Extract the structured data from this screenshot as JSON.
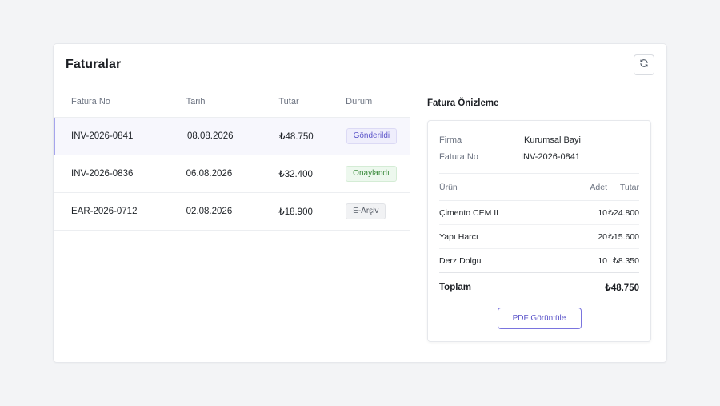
{
  "header": {
    "title": "Faturalar",
    "refresh_icon": "refresh-icon"
  },
  "invoices": {
    "columns": [
      "Fatura No",
      "Tarih",
      "Tutar",
      "Durum"
    ],
    "rows": [
      {
        "no": "INV-2026-0841",
        "date": "08.08.2026",
        "amount": "₺48.750",
        "status": "Gönderildi",
        "status_type": "sent",
        "selected": true
      },
      {
        "no": "INV-2026-0836",
        "date": "06.08.2026",
        "amount": "₺32.400",
        "status": "Onaylandı",
        "status_type": "approved",
        "selected": false
      },
      {
        "no": "EAR-2026-0712",
        "date": "02.08.2026",
        "amount": "₺18.900",
        "status": "E-Arşiv",
        "status_type": "archive",
        "selected": false
      }
    ]
  },
  "preview": {
    "title": "Fatura Önizleme",
    "firma_label": "Firma",
    "firma_value": "Kurumsal Bayi",
    "invoice_label": "Fatura No",
    "invoice_value": "INV-2026-0841",
    "columns": [
      "Ürün",
      "Adet",
      "Tutar"
    ],
    "items": [
      {
        "product": "Çimento CEM II",
        "qty": "10",
        "amount": "₺24.800"
      },
      {
        "product": "Yapı Harcı",
        "qty": "20",
        "amount": "₺15.600"
      },
      {
        "product": "Derz Dolgu",
        "qty": "10",
        "amount": "₺8.350"
      }
    ],
    "total_label": "Toplam",
    "total_value": "₺48.750",
    "pdf_button": "PDF Görüntüle"
  },
  "colors": {
    "accent": "#5b54c9",
    "selected_row_bg": "#f7f7fd",
    "approved": "#3a8a3c"
  }
}
